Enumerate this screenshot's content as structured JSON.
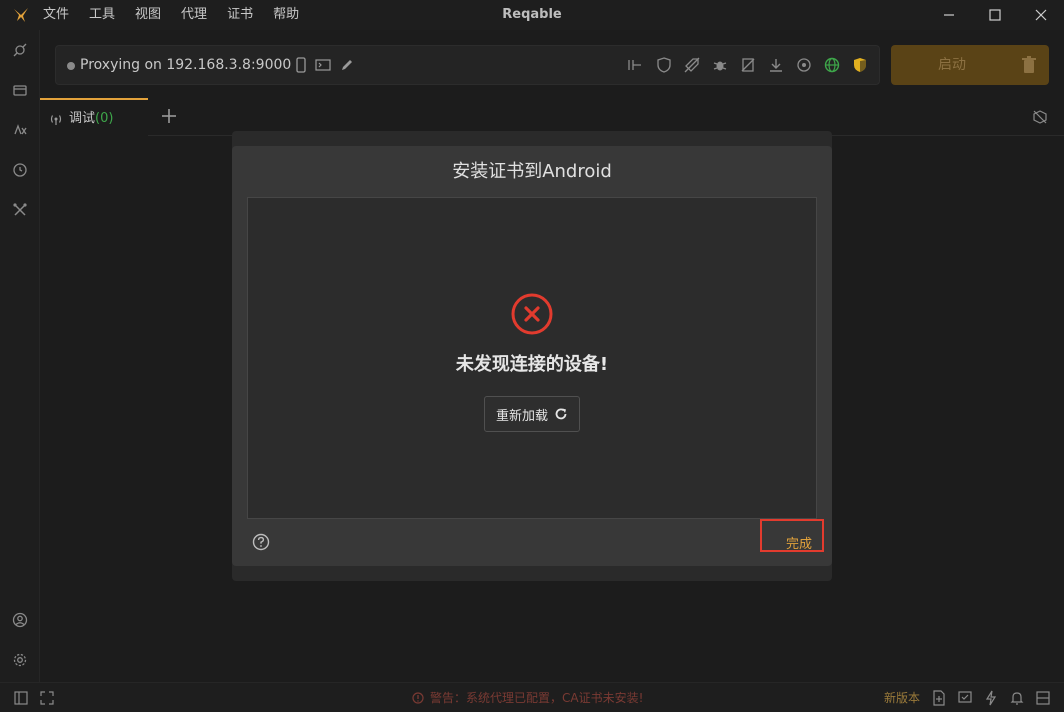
{
  "titlebar": {
    "app_title": "Reqable",
    "menu": [
      "文件",
      "工具",
      "视图",
      "代理",
      "证书",
      "帮助"
    ]
  },
  "proxy": {
    "status_text": "Proxying on 192.168.3.8:9000",
    "start_label": "启动"
  },
  "tabs": [
    {
      "label": "调试",
      "count": "(0)"
    }
  ],
  "modal": {
    "title": "安装证书到Android",
    "error_text": "未发现连接的设备!",
    "reload_label": "重新加载",
    "done_label": "完成"
  },
  "statusbar": {
    "warning": "警告：系统代理已配置，CA证书未安装!",
    "new_version": "新版本"
  },
  "colors": {
    "accent": "#e2a23b",
    "error": "#e23b2e",
    "success": "#3ea64a",
    "start_bg": "#5a4316"
  }
}
